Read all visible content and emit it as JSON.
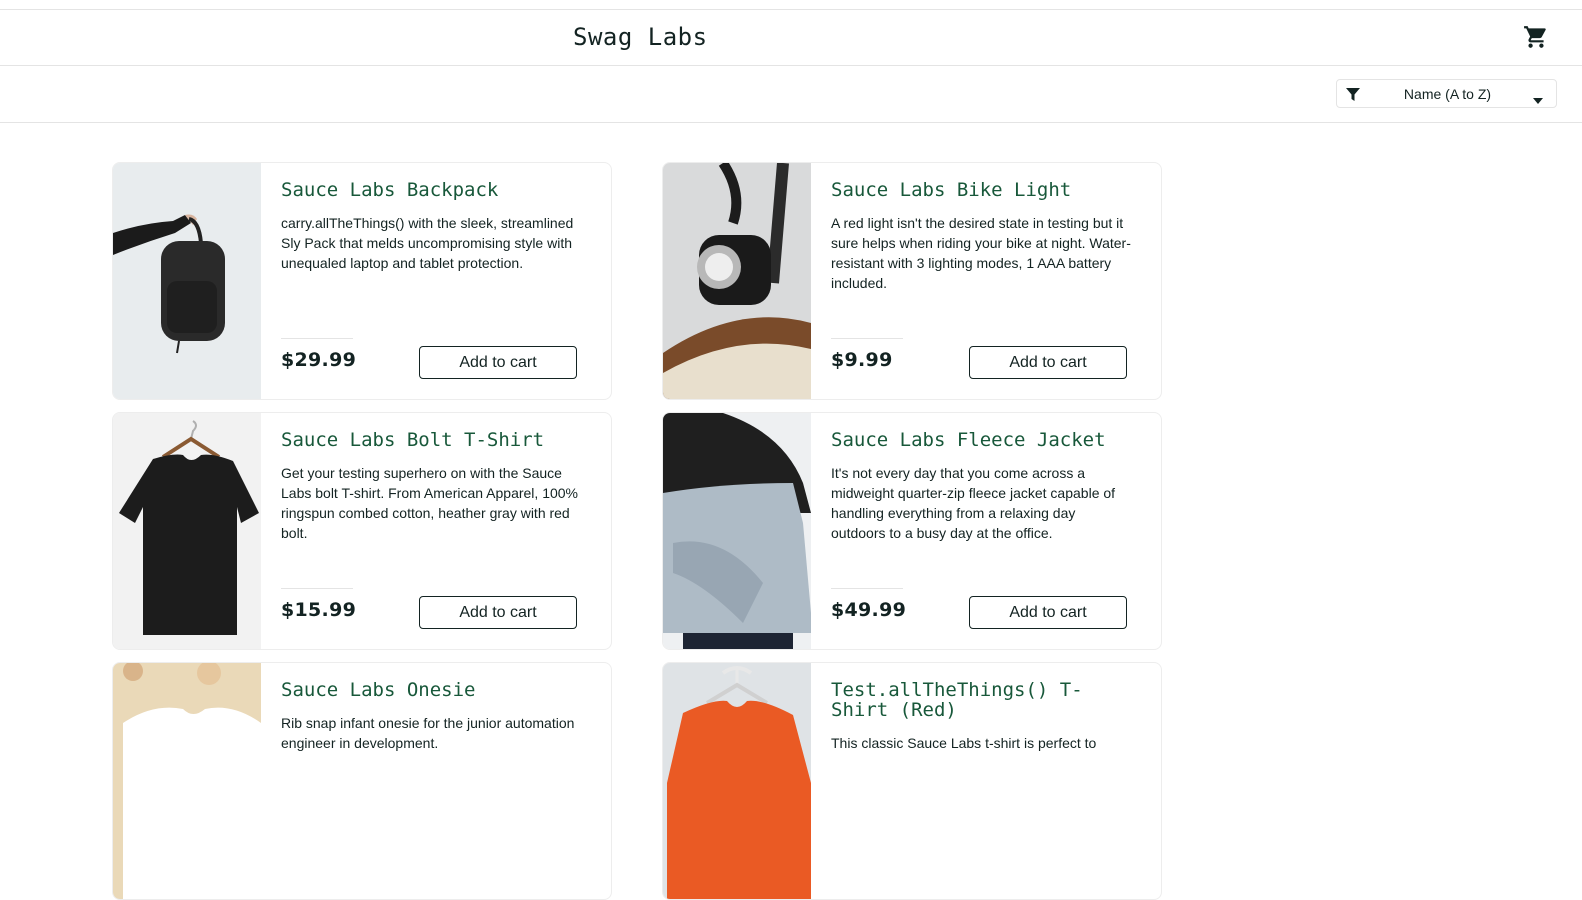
{
  "header": {
    "app_title": "Swag Labs",
    "cart_icon": "shopping-cart-icon"
  },
  "sort": {
    "selected": "Name (A to Z)",
    "filter_icon": "filter-icon",
    "caret_icon": "caret-down-icon"
  },
  "products": [
    {
      "name": "Sauce Labs Backpack",
      "description": "carry.allTheThings() with the sleek, streamlined Sly Pack that melds uncompromising style with unequaled laptop and tablet protection.",
      "price": "$29.99",
      "button": "Add to cart"
    },
    {
      "name": "Sauce Labs Bike Light",
      "description": "A red light isn't the desired state in testing but it sure helps when riding your bike at night. Water-resistant with 3 lighting modes, 1 AAA battery included.",
      "price": "$9.99",
      "button": "Add to cart"
    },
    {
      "name": "Sauce Labs Bolt T-Shirt",
      "description": "Get your testing superhero on with the Sauce Labs bolt T-shirt. From American Apparel, 100% ringspun combed cotton, heather gray with red bolt.",
      "price": "$15.99",
      "button": "Add to cart"
    },
    {
      "name": "Sauce Labs Fleece Jacket",
      "description": "It's not every day that you come across a midweight quarter-zip fleece jacket capable of handling everything from a relaxing day outdoors to a busy day at the office.",
      "price": "$49.99",
      "button": "Add to cart"
    },
    {
      "name": "Sauce Labs Onesie",
      "description": "Rib snap infant onesie for the junior automation engineer in development.",
      "price": "",
      "button": ""
    },
    {
      "name": "Test.allTheThings() T-Shirt (Red)",
      "description": "This classic Sauce Labs t-shirt is perfect to",
      "price": "",
      "button": ""
    }
  ]
}
